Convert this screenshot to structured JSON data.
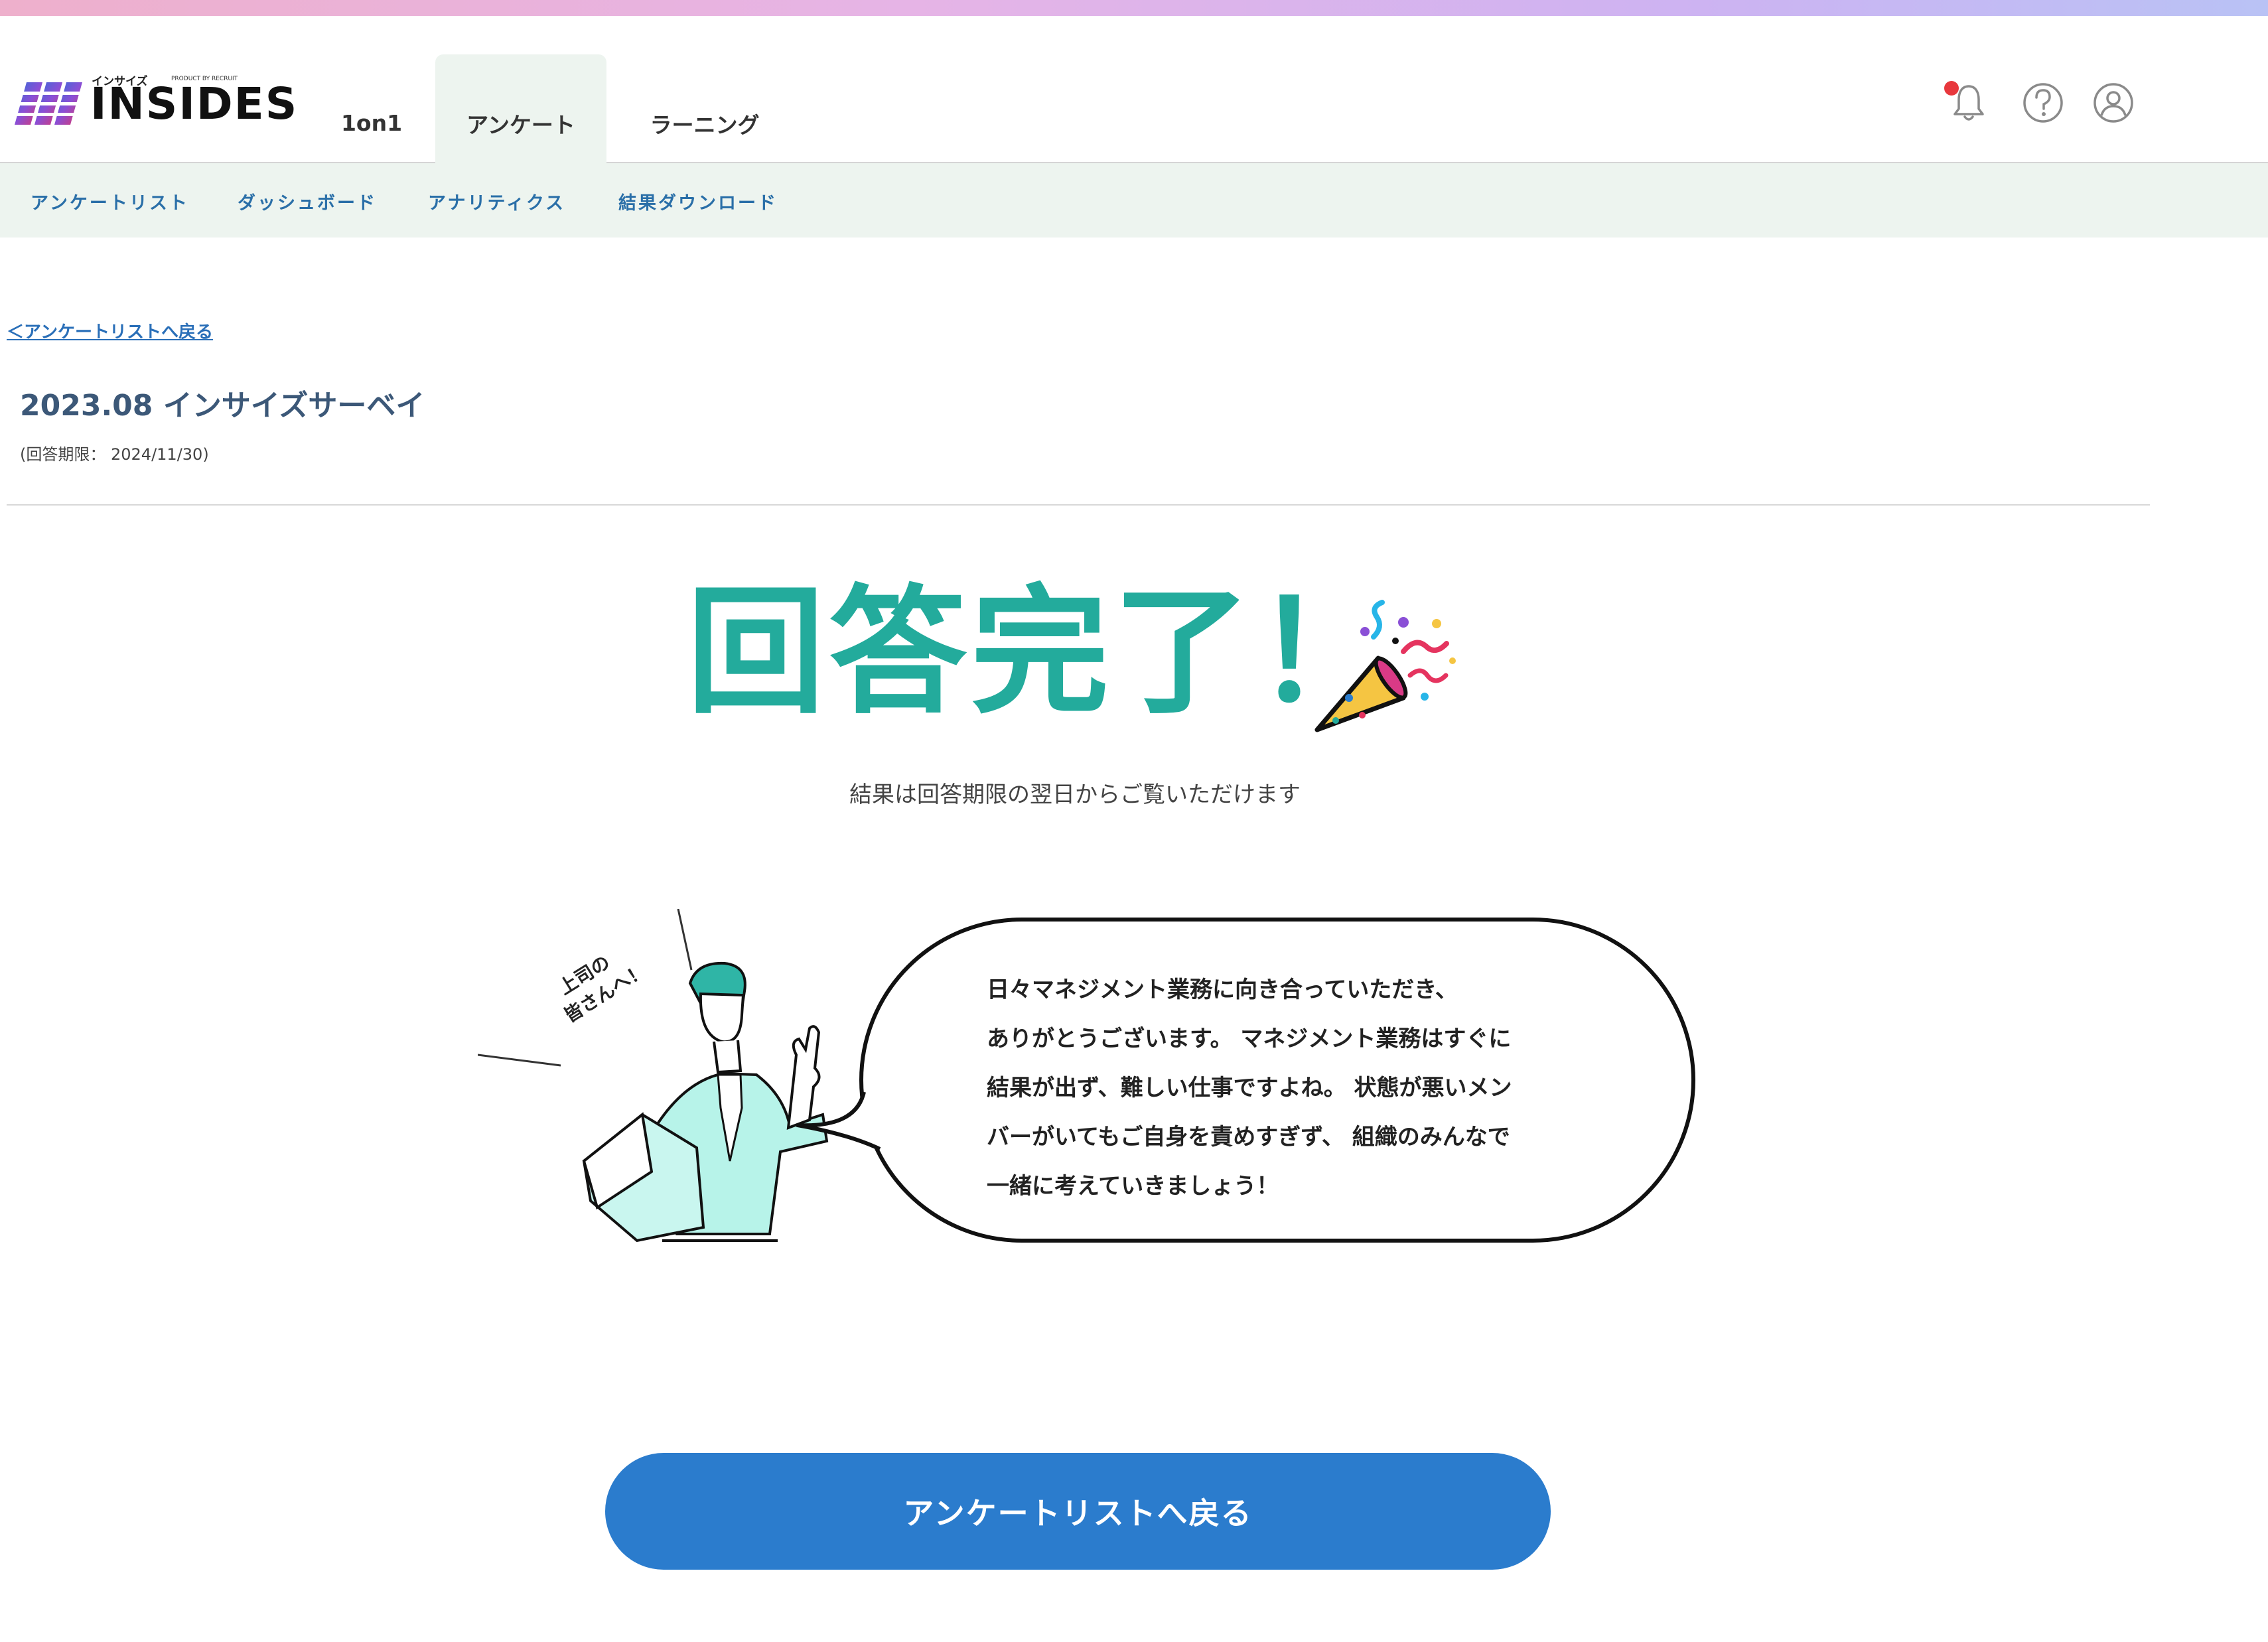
{
  "brand": {
    "logo_small": "インサイズ",
    "logo_tiny": "PRODUCT BY RECRUIT",
    "logo_text": "INSIDES"
  },
  "main_tabs": [
    {
      "label": "1on1"
    },
    {
      "label": "アンケート",
      "active": true
    },
    {
      "label": "ラーニング"
    }
  ],
  "header_icons": [
    "bell-icon",
    "help-icon",
    "account-icon"
  ],
  "sub_nav": [
    {
      "label": "アンケートリスト"
    },
    {
      "label": "ダッシュボード"
    },
    {
      "label": "アナリティクス"
    },
    {
      "label": "結果ダウンロード"
    }
  ],
  "page": {
    "back_link": "＜アンケートリストへ戻る",
    "survey_title": "2023.08 インサイズサーベイ",
    "deadline": "(回答期限： 2024/11/30)",
    "complete_title": "回答完了！",
    "result_note": "結果は回答期限の翌日からご覧いただけます"
  },
  "illustration": {
    "caption_line1": "上司の",
    "caption_line2": "皆さんへ！"
  },
  "bubble": {
    "lines": [
      "日々マネジメント業務に向き合っていただき、",
      "ありがとうございます。 マネジメント業務はすぐに",
      "結果が出ず、難しい仕事ですよね。 状態が悪いメン",
      "バーがいてもご自身を責めすぎず、 組織のみんなで",
      "一緒に考えていきましょう！"
    ]
  },
  "cta": {
    "label": "アンケートリストへ戻る"
  },
  "colors": {
    "accent_teal": "#23ab9c",
    "button_blue": "#2b7ccd",
    "link_blue": "#2a6fa8",
    "subnav_bg": "#edf4ef",
    "notification_red": "#e8383d"
  }
}
